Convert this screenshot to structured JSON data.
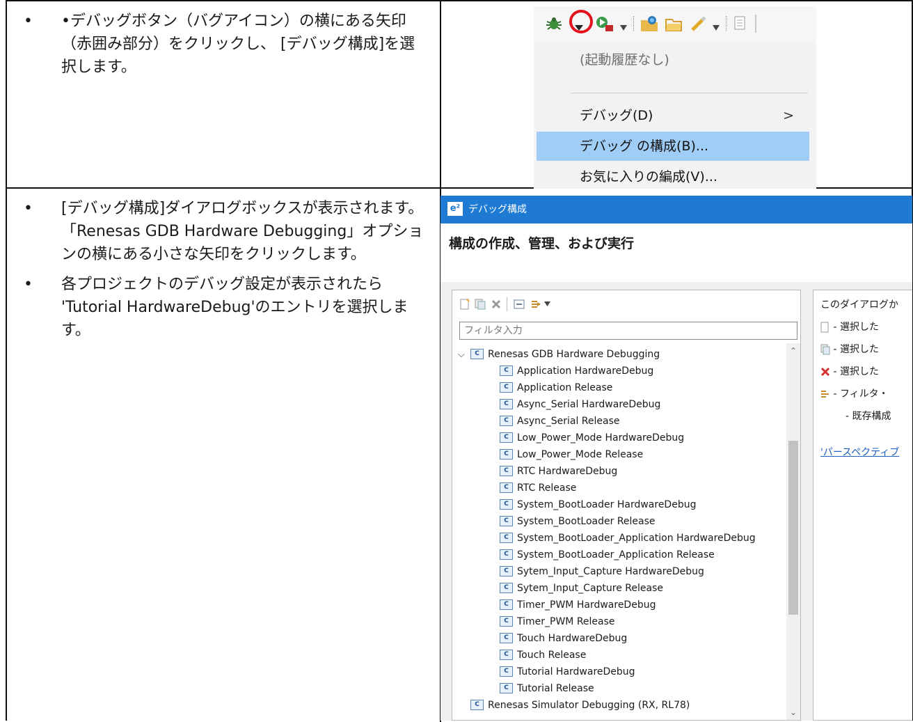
{
  "row1": {
    "bullets": [
      "•デバッグボタン（バグアイコン）の横にある矢印（赤囲み部分）をクリックし、 [デバッグ構成]を選択します。"
    ]
  },
  "row2": {
    "bullets": [
      "[デバッグ構成]ダイアログボックスが表示されます。 「Renesas GDB Hardware Debugging」オプションの横にある小さな矢印をクリックします。",
      "各プロジェクトのデバッグ設定が表示されたら 'Tutorial HardwareDebug'のエントリを選択します。"
    ]
  },
  "menu": {
    "no_history": "(起動履歴なし)",
    "debug": "デバッグ(D)",
    "debug_configs": "デバッグ の構成(B)...",
    "favorites": "お気に入りの編成(V)...",
    "submenu_chevron": ">"
  },
  "dialog": {
    "title": "デバッグ構成",
    "app_badge": "e²",
    "heading": "構成の作成、管理、および実行",
    "filter_placeholder": "フィルタ入力",
    "tree_root": "Renesas GDB Hardware Debugging",
    "tree_items": [
      "Application HardwareDebug",
      "Application Release",
      "Async_Serial HardwareDebug",
      "Async_Serial Release",
      "Low_Power_Mode HardwareDebug",
      "Low_Power_Mode Release",
      "RTC HardwareDebug",
      "RTC Release",
      "System_BootLoader HardwareDebug",
      "System_BootLoader Release",
      "System_BootLoader_Application HardwareDebug",
      "System_BootLoader_Application Release",
      "Sytem_Input_Capture HardwareDebug",
      "Sytem_Input_Capture Release",
      "Timer_PWM HardwareDebug",
      "Timer_PWM Release",
      "Touch HardwareDebug",
      "Touch Release",
      "Tutorial HardwareDebug",
      "Tutorial Release"
    ],
    "tree_second_root": "Renesas Simulator Debugging (RX, RL78)",
    "right_pane": {
      "intro": "このダイアログか",
      "new_line": "- 選択した",
      "dup_line": "- 選択した",
      "del_line": "- 選択した",
      "filter_line": "- フィルタ・",
      "existing_line": "- 既存構成",
      "perspective_link": "'パースペクティブ"
    }
  },
  "colors": {
    "highlight": "#9fcdf5",
    "title_bar": "#1e7ad3",
    "red_ring": "#e3121b"
  }
}
